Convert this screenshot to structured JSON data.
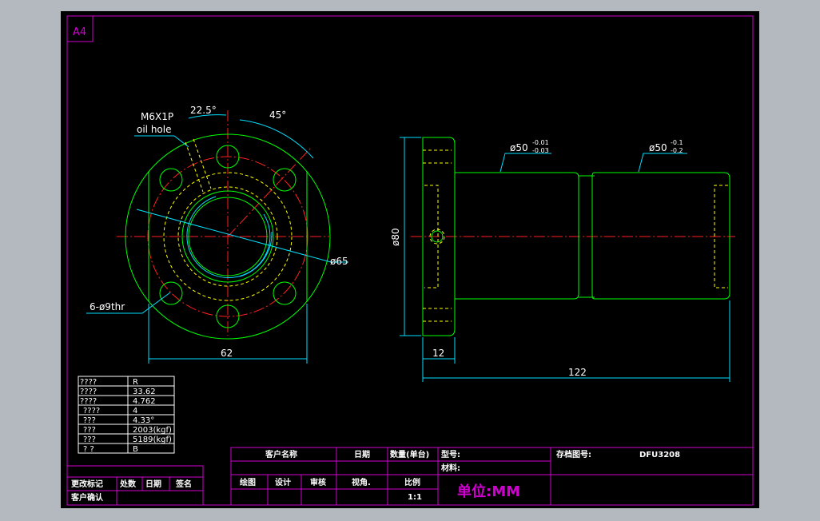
{
  "sheet": {
    "size_label": "A4",
    "colors": {
      "background": "#000000",
      "frame": "#d000d0",
      "outline": "#00ff00",
      "center": "#ff2020",
      "hidden": "#ffff00",
      "dimension": "#00e0ff",
      "text": "#ffffff"
    }
  },
  "front_view": {
    "thread_label": "M6X1P",
    "oil_label": "oil hole",
    "angle_a": "22.5°",
    "angle_b": "45°",
    "hole_label": "6-ø9thr",
    "pcd_label": "ø65",
    "width_label": "62"
  },
  "side_view": {
    "flange_dia_label": "ø80",
    "body_dia_1": "ø50",
    "body_tol_1_upper": "-0.01",
    "body_tol_1_lower": "-0.03",
    "body_dia_2": "ø50",
    "body_tol_2_upper": "-0.1",
    "body_tol_2_lower": "-0.2",
    "flange_len_label": "12",
    "total_len_label": "122"
  },
  "spec_table": [
    {
      "k": "????",
      "v": "R"
    },
    {
      "k": "????",
      "v": "33.62"
    },
    {
      "k": "????",
      "v": "4.762"
    },
    {
      "k": "????",
      "v": "4"
    },
    {
      "k": "???",
      "v": "4.33°"
    },
    {
      "k": "???",
      "v": "2003(kgf)"
    },
    {
      "k": "???",
      "v": "5189(kgf)"
    },
    {
      "k": "?  ?",
      "v": "B"
    }
  ],
  "revision_block": {
    "change_mark": "更改标记",
    "location": "处数",
    "date": "日期",
    "signature": "签名",
    "customer_confirm": "客户确认"
  },
  "title_block": {
    "customer_name": "客户名称",
    "date": "日期",
    "quantity": "数量(单台)",
    "model": "型号:",
    "drawing_no_label": "存档图号:",
    "drawing_no": "DFU3208",
    "material": "材料:",
    "drawn": "绘图",
    "design": "设计",
    "review": "审核",
    "view_angle": "视角.",
    "scale_label": "比例",
    "scale": "1:1",
    "unit": "单位:MM"
  }
}
